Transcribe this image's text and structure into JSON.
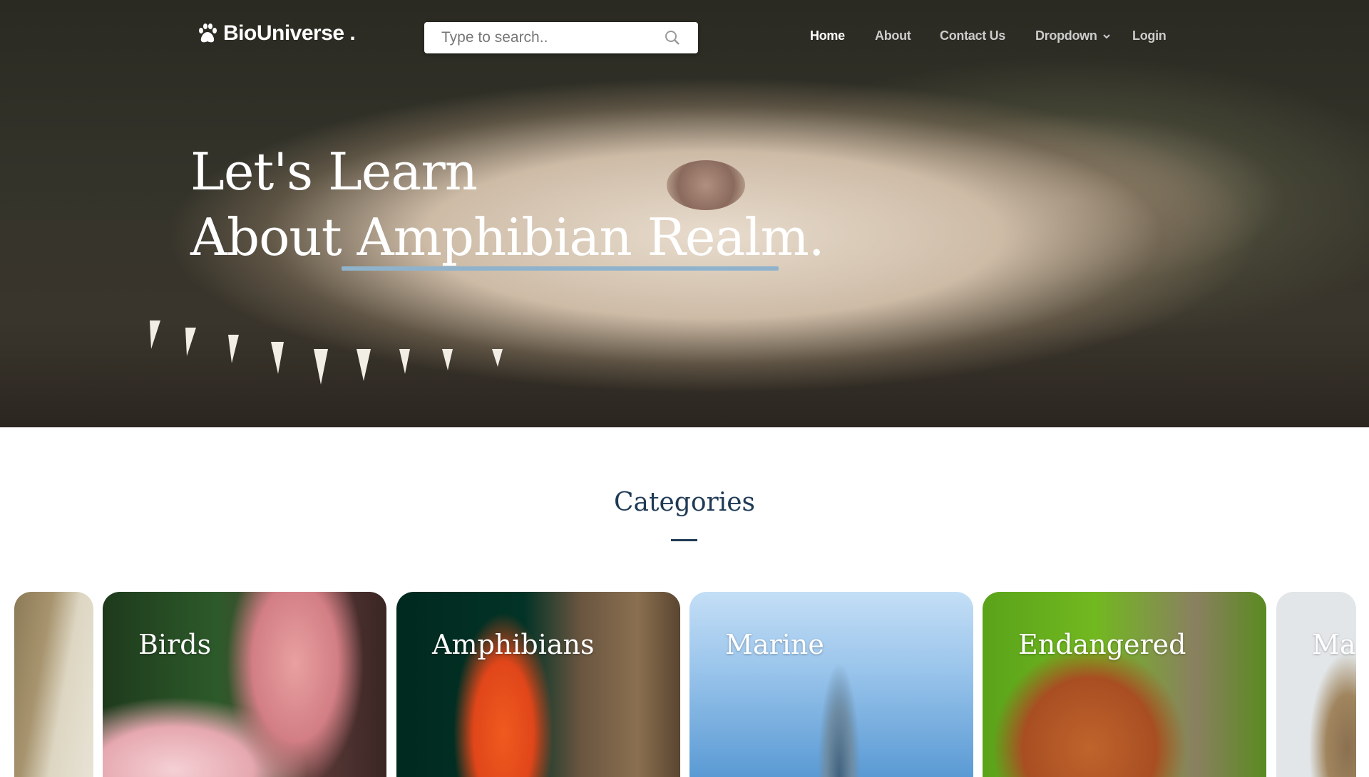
{
  "header": {
    "logo": "BioUniverse .",
    "search_placeholder": "Type to search..",
    "nav": [
      {
        "label": "Home"
      },
      {
        "label": "About"
      },
      {
        "label": "Contact Us"
      },
      {
        "label": "Dropdown"
      },
      {
        "label": "Login"
      }
    ]
  },
  "hero": {
    "line1": "Let's Learn",
    "line2": "About Amphibian Realm.",
    "underline_color": "#8fb3cc"
  },
  "categories": {
    "title": "Categories",
    "cards": [
      {
        "label": ""
      },
      {
        "label": "Birds"
      },
      {
        "label": "Amphibians"
      },
      {
        "label": "Marine"
      },
      {
        "label": "Endangered"
      },
      {
        "label": "Ma"
      }
    ]
  },
  "colors": {
    "accent": "#1f3a56"
  }
}
